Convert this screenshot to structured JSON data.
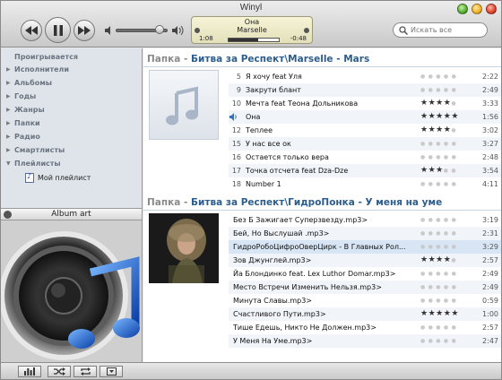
{
  "window": {
    "title": "Winyl"
  },
  "now_playing": {
    "track": "Она",
    "artist": "Marselle",
    "elapsed": "1:08",
    "remaining": "-0:48",
    "progress": 0.59
  },
  "volume": {
    "level": 0.85
  },
  "search": {
    "placeholder": "Искать все"
  },
  "sidebar": {
    "items": [
      {
        "label": "Проигрывается",
        "arrow": ""
      },
      {
        "label": "Исполнители",
        "arrow": "▶"
      },
      {
        "label": "Альбомы",
        "arrow": "▶"
      },
      {
        "label": "Годы",
        "arrow": "▶"
      },
      {
        "label": "Жанры",
        "arrow": "▶"
      },
      {
        "label": "Папки",
        "arrow": "▶"
      },
      {
        "label": "Радио",
        "arrow": "▶"
      },
      {
        "label": "Смартлисты",
        "arrow": "▶"
      },
      {
        "label": "Плейлисты",
        "arrow": "▼"
      }
    ],
    "playlist": "Мой плейлист"
  },
  "album_art": {
    "label": "Album art"
  },
  "folders": [
    {
      "prefix": "Папка - ",
      "path": "Битва за Респект\\Marselle - Mars",
      "tracks": [
        {
          "num": "5",
          "title": "Я хочу feat Уля",
          "rating": 0,
          "duration": "2:22"
        },
        {
          "num": "9",
          "title": "Закрути блант",
          "rating": 0,
          "duration": "2:49"
        },
        {
          "num": "10",
          "title": "Мечта feat Теона Дольникова",
          "rating": 4,
          "duration": "3:33"
        },
        {
          "num": "",
          "title": "Она",
          "rating": 5,
          "duration": "1:56",
          "playing": true
        },
        {
          "num": "12",
          "title": "Теплее",
          "rating": 4,
          "duration": "3:02"
        },
        {
          "num": "15",
          "title": "У нас все ок",
          "rating": 0,
          "duration": "3:27"
        },
        {
          "num": "16",
          "title": "Остается только вера",
          "rating": 0,
          "duration": "2:48"
        },
        {
          "num": "17",
          "title": "Точка отсчета feat Dza-Dze",
          "rating": 3,
          "duration": "3:54"
        },
        {
          "num": "18",
          "title": "Number 1",
          "rating": 0,
          "duration": "4:11"
        }
      ]
    },
    {
      "prefix": "Папка - ",
      "path": "Битва за Респект\\ГидроПонка - У меня на уме",
      "tracks": [
        {
          "title": "Без Б Зажигает Суперзвезду.mp3>",
          "rating": 0,
          "duration": "3:19"
        },
        {
          "title": "Бей, Но Выслушай .mp3>",
          "rating": 0,
          "duration": "2:31"
        },
        {
          "title": "ГидроРобоЦифроОверЦирк - В Главных Рол...",
          "rating": 0,
          "duration": "3:29",
          "selected": true
        },
        {
          "title": "Зов Джунглей.mp3>",
          "rating": 4,
          "duration": "2:57"
        },
        {
          "title": "Йа Блондинко feat. Lex Luthor  Domar.mp3>",
          "rating": 0,
          "duration": "2:49"
        },
        {
          "title": "Место Встречи Изменить Нельзя.mp3>",
          "rating": 0,
          "duration": "2:49"
        },
        {
          "title": "Минута Славы.mp3>",
          "rating": 0,
          "duration": "0:59"
        },
        {
          "title": "Счастливого Пути.mp3>",
          "rating": 5,
          "duration": "1:00"
        },
        {
          "title": "Тише Едешь, Никто Не Должен.mp3>",
          "rating": 0,
          "duration": "2:57"
        },
        {
          "title": "У Меня На Уме.mp3>",
          "rating": 0,
          "duration": "2:47"
        }
      ]
    }
  ],
  "colors": {
    "folder_path": "#2c5d8c",
    "row_alt": "#f1f4f8",
    "row_selected": "#d7e5f4",
    "sidebar_bg": "#dfe4ea"
  }
}
